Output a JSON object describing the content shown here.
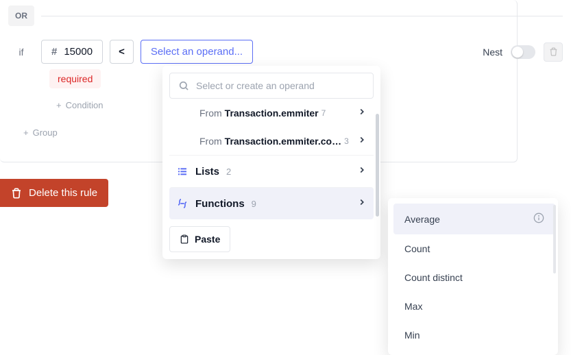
{
  "or_label": "OR",
  "if_label": "if",
  "operand_value": "15000",
  "operator": "<",
  "select_operand_text": "Select an operand...",
  "nest_label": "Nest",
  "required_label": "required",
  "add_condition_label": "Condition",
  "add_group_label": "Group",
  "delete_button_label": "Delete this rule",
  "dropdown": {
    "search_placeholder": "Select or create an operand",
    "from_rows": [
      {
        "prefix": "From ",
        "bold": "Transaction.emmiter",
        "count": "7"
      },
      {
        "prefix": "From ",
        "bold": "Transaction.emmiter.co…",
        "count": "3"
      }
    ],
    "lists_label": "Lists",
    "lists_count": "2",
    "functions_label": "Functions",
    "functions_count": "9",
    "paste_label": "Paste"
  },
  "functions_menu": [
    "Average",
    "Count",
    "Count distinct",
    "Max",
    "Min"
  ]
}
